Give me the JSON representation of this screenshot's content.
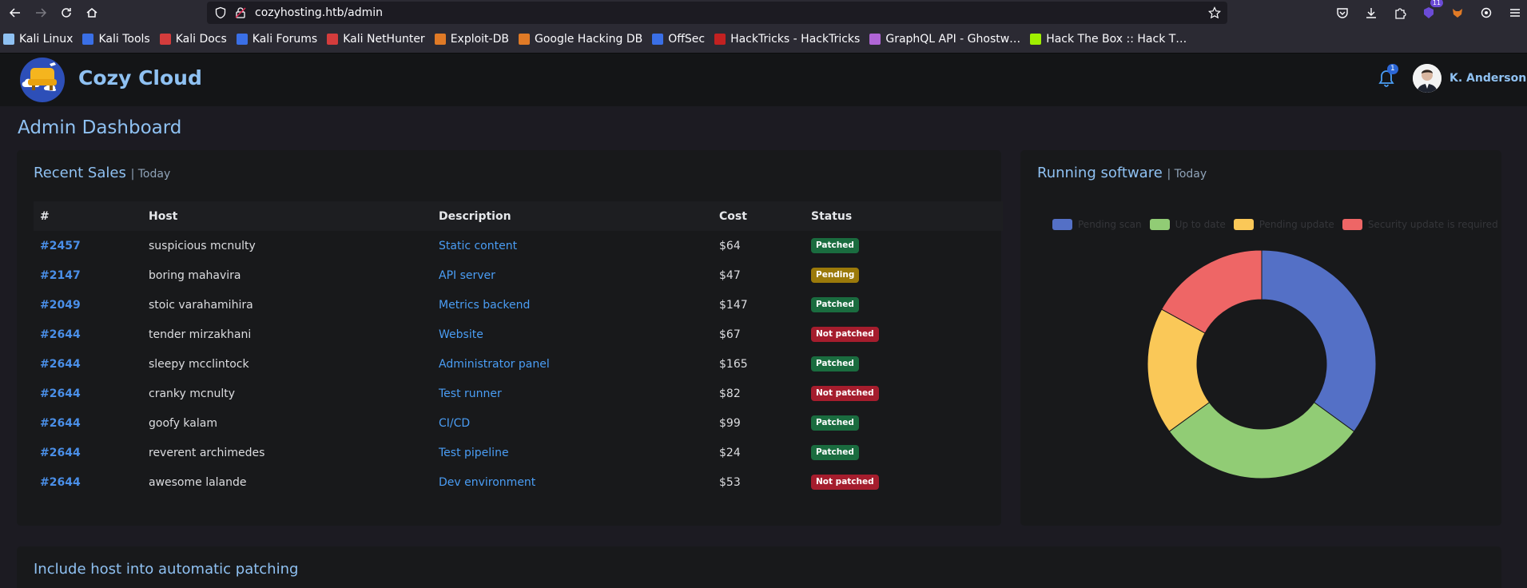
{
  "browser": {
    "url": "cozyhosting.htb/admin",
    "extension_badge": "11"
  },
  "bookmarks": [
    {
      "label": "Kali Linux",
      "color": "#8fc1f2"
    },
    {
      "label": "Kali Tools",
      "color": "#3a6fe6"
    },
    {
      "label": "Kali Docs",
      "color": "#d43c3c"
    },
    {
      "label": "Kali Forums",
      "color": "#3a6fe6"
    },
    {
      "label": "Kali NetHunter",
      "color": "#d43c3c"
    },
    {
      "label": "Exploit-DB",
      "color": "#e07a26"
    },
    {
      "label": "Google Hacking DB",
      "color": "#e07a26"
    },
    {
      "label": "OffSec",
      "color": "#3a6fe6"
    },
    {
      "label": "HackTricks - HackTricks",
      "color": "#c22121"
    },
    {
      "label": "GraphQL API - Ghostw…",
      "color": "#b065d6"
    },
    {
      "label": "Hack The Box :: Hack T…",
      "color": "#9fef00"
    }
  ],
  "header": {
    "brand": "Cozy Cloud",
    "notification_count": "1",
    "username": "K. Anderson"
  },
  "page": {
    "title": "Admin Dashboard"
  },
  "sales": {
    "title": "Recent Sales",
    "subtitle": "| Today",
    "columns": [
      "#",
      "Host",
      "Description",
      "Cost",
      "Status"
    ],
    "rows": [
      {
        "id": "#2457",
        "host": "suspicious mcnulty",
        "desc": "Static content",
        "cost": "$64",
        "status": "Patched",
        "status_type": "patched"
      },
      {
        "id": "#2147",
        "host": "boring mahavira",
        "desc": "API server",
        "cost": "$47",
        "status": "Pending",
        "status_type": "pending"
      },
      {
        "id": "#2049",
        "host": "stoic varahamihira",
        "desc": "Metrics backend",
        "cost": "$147",
        "status": "Patched",
        "status_type": "patched"
      },
      {
        "id": "#2644",
        "host": "tender mirzakhani",
        "desc": "Website",
        "cost": "$67",
        "status": "Not patched",
        "status_type": "notpatched"
      },
      {
        "id": "#2644",
        "host": "sleepy mcclintock",
        "desc": "Administrator panel",
        "cost": "$165",
        "status": "Patched",
        "status_type": "patched"
      },
      {
        "id": "#2644",
        "host": "cranky mcnulty",
        "desc": "Test runner",
        "cost": "$82",
        "status": "Not patched",
        "status_type": "notpatched"
      },
      {
        "id": "#2644",
        "host": "goofy kalam",
        "desc": "CI/CD",
        "cost": "$99",
        "status": "Patched",
        "status_type": "patched"
      },
      {
        "id": "#2644",
        "host": "reverent archimedes",
        "desc": "Test pipeline",
        "cost": "$24",
        "status": "Patched",
        "status_type": "patched"
      },
      {
        "id": "#2644",
        "host": "awesome lalande",
        "desc": "Dev environment",
        "cost": "$53",
        "status": "Not patched",
        "status_type": "notpatched"
      }
    ]
  },
  "software": {
    "title": "Running software",
    "subtitle": "| Today"
  },
  "patching": {
    "title": "Include host into automatic patching"
  },
  "chart_data": {
    "type": "pie",
    "style": "doughnut",
    "legend_position": "top",
    "categories": [
      "Pending scan",
      "Up to date",
      "Pending update",
      "Security update is required"
    ],
    "values": [
      35,
      30,
      18,
      17
    ],
    "colors": [
      "#5470c6",
      "#91cc75",
      "#fac858",
      "#ee6666"
    ]
  }
}
